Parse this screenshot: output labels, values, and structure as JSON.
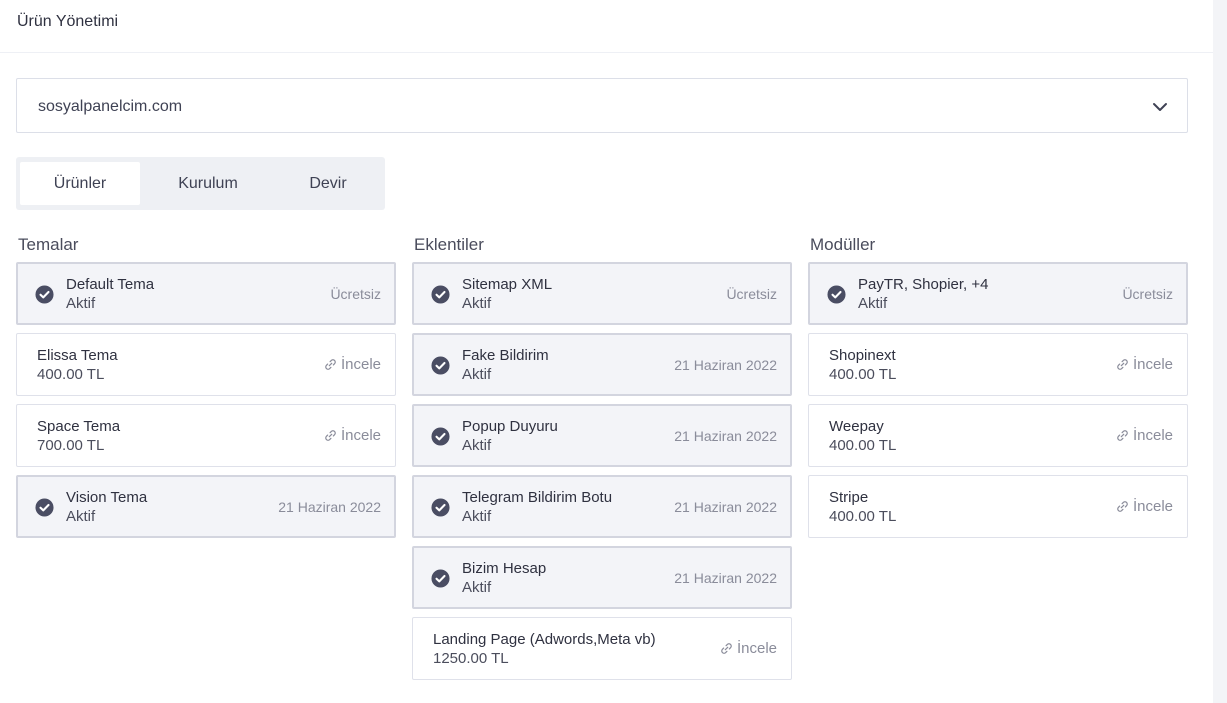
{
  "header": {
    "title": "Ürün Yönetimi"
  },
  "domain_select": {
    "value": "sosyalpanelcim.com",
    "icon": "chevron-down-icon"
  },
  "tabs": [
    {
      "label": "Ürünler",
      "active": true
    },
    {
      "label": "Kurulum",
      "active": false
    },
    {
      "label": "Devir",
      "active": false
    }
  ],
  "columns": [
    {
      "heading": "Temalar",
      "items": [
        {
          "name": "Default Tema",
          "sub": "Aktif",
          "right": "Ücretsiz",
          "active": true
        },
        {
          "name": "Elissa Tema",
          "sub": "400.00 TL",
          "right": "İncele",
          "active": false
        },
        {
          "name": "Space Tema",
          "sub": "700.00 TL",
          "right": "İncele",
          "active": false
        },
        {
          "name": "Vision Tema",
          "sub": "Aktif",
          "right": "21 Haziran 2022",
          "active": true
        }
      ]
    },
    {
      "heading": "Eklentiler",
      "items": [
        {
          "name": "Sitemap XML",
          "sub": "Aktif",
          "right": "Ücretsiz",
          "active": true
        },
        {
          "name": "Fake Bildirim",
          "sub": "Aktif",
          "right": "21 Haziran 2022",
          "active": true
        },
        {
          "name": "Popup Duyuru",
          "sub": "Aktif",
          "right": "21 Haziran 2022",
          "active": true
        },
        {
          "name": "Telegram Bildirim Botu",
          "sub": "Aktif",
          "right": "21 Haziran 2022",
          "active": true
        },
        {
          "name": "Bizim Hesap",
          "sub": "Aktif",
          "right": "21 Haziran 2022",
          "active": true
        },
        {
          "name": "Landing Page (Adwords,Meta vb)",
          "sub": "1250.00 TL",
          "right": "İncele",
          "active": false
        }
      ]
    },
    {
      "heading": "Modüller",
      "items": [
        {
          "name": "PayTR, Shopier, +4",
          "sub": "Aktif",
          "right": "Ücretsiz",
          "active": true
        },
        {
          "name": "Shopinext",
          "sub": "400.00 TL",
          "right": "İncele",
          "active": false
        },
        {
          "name": "Weepay",
          "sub": "400.00 TL",
          "right": "İncele",
          "active": false
        },
        {
          "name": "Stripe",
          "sub": "400.00 TL",
          "right": "İncele",
          "active": false
        }
      ]
    }
  ],
  "colors": {
    "check": "#4a4d63",
    "active_bg": "#f3f4f8",
    "tab_bg": "#eef0f4"
  }
}
